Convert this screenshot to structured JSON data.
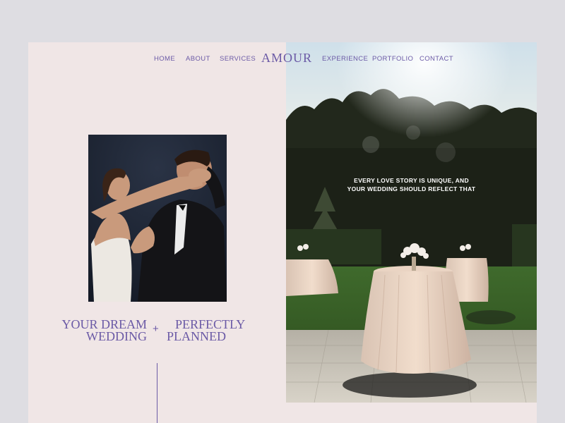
{
  "nav": {
    "brand": "AMOUR",
    "left_links": [
      "HOME",
      "ABOUT",
      "SERVICES"
    ],
    "right_links": [
      "EXPERIENCE",
      "PORTFOLIO",
      "CONTACT"
    ]
  },
  "hero": {
    "headline_left": [
      "YOUR DREAM",
      "WEDDING"
    ],
    "headline_plus": "+",
    "headline_right": [
      "PERFECTLY",
      "PLANNED"
    ],
    "tagline_lines": [
      "EVERY LOVE STORY IS UNIQUE, AND",
      "YOUR WEDDING SHOULD REFLECT THAT"
    ]
  },
  "colors": {
    "background": "#dedde2",
    "page": "#f0e6e6",
    "accent": "#6b5aa6"
  }
}
